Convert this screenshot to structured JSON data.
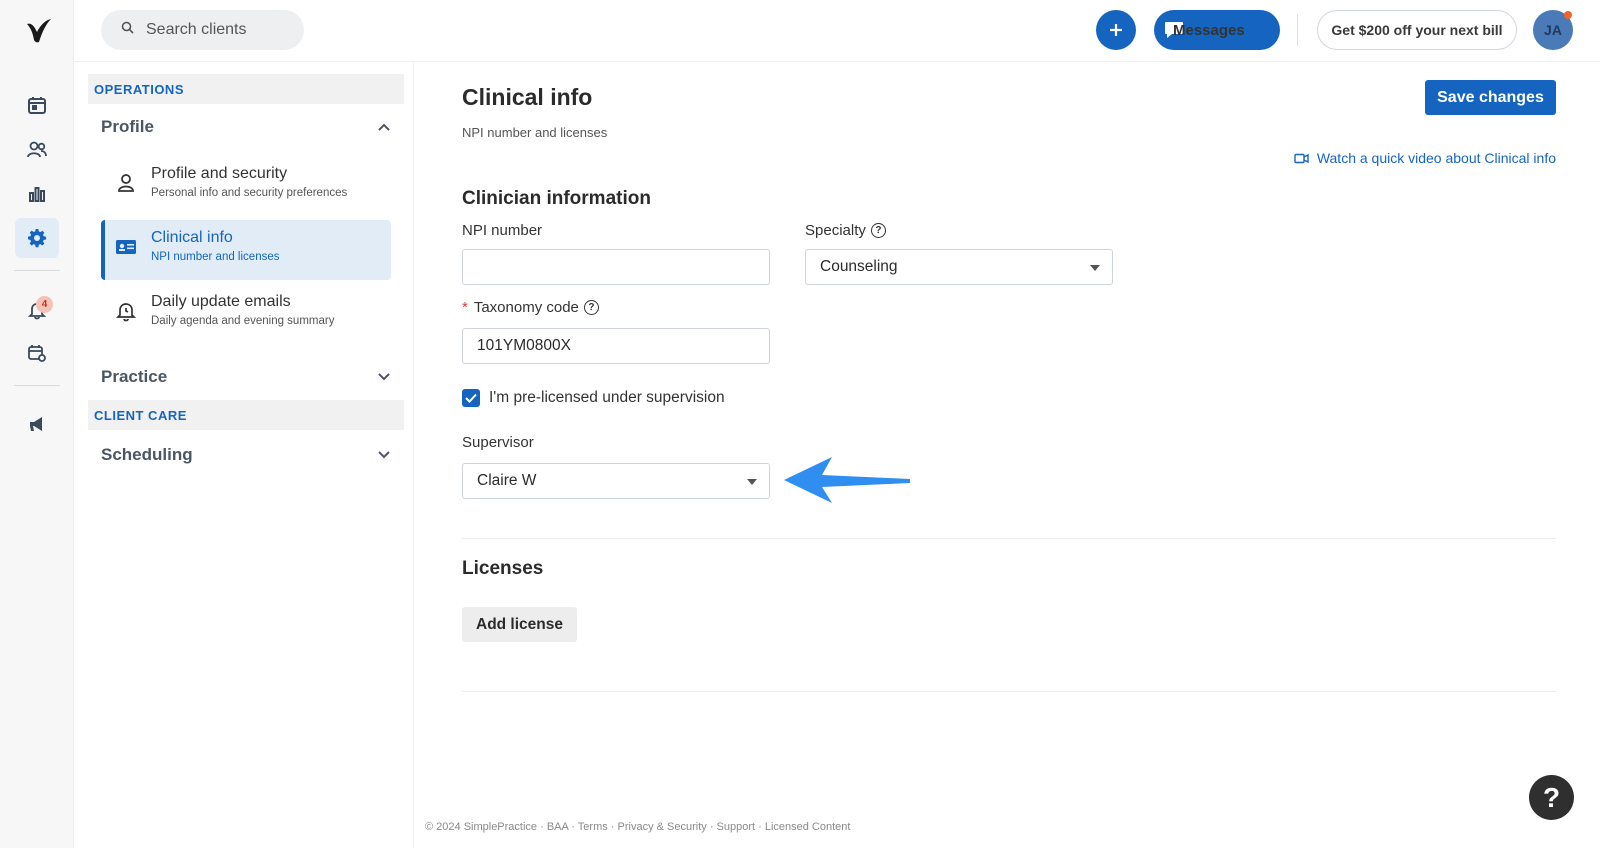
{
  "header": {
    "search_placeholder": "Search clients",
    "messages_label": "Messages",
    "promo_label": "Get $200 off your next bill",
    "avatar_initials": "JA",
    "notification_count": "4"
  },
  "sidebar": {
    "operations_label": "OPERATIONS",
    "client_care_label": "CLIENT CARE",
    "groups": {
      "profile": "Profile",
      "practice": "Practice",
      "scheduling": "Scheduling"
    },
    "items": [
      {
        "title": "Profile and security",
        "desc": "Personal info and security preferences"
      },
      {
        "title": "Clinical info",
        "desc": "NPI number and licenses"
      },
      {
        "title": "Daily update emails",
        "desc": "Daily agenda and evening summary"
      }
    ]
  },
  "main": {
    "title": "Clinical info",
    "subtitle": "NPI number and licenses",
    "save_label": "Save changes",
    "video_link": "Watch a quick video about Clinical info",
    "clinician_heading": "Clinician information",
    "npi_label": "NPI number",
    "npi_value": "",
    "specialty_label": "Specialty",
    "specialty_value": "Counseling",
    "taxonomy_label": "Taxonomy code",
    "taxonomy_value": "101YM0800X",
    "prelicensed_label": "I'm pre-licensed under supervision",
    "prelicensed_checked": true,
    "supervisor_label": "Supervisor",
    "supervisor_value": "Claire W",
    "licenses_heading": "Licenses",
    "add_license_label": "Add license"
  },
  "footer": {
    "text": "© 2024 SimplePractice · BAA · Terms · Privacy & Security · Support · Licensed Content"
  },
  "colors": {
    "accent": "#1565c0",
    "annotation_arrow": "#2f8ef0"
  }
}
